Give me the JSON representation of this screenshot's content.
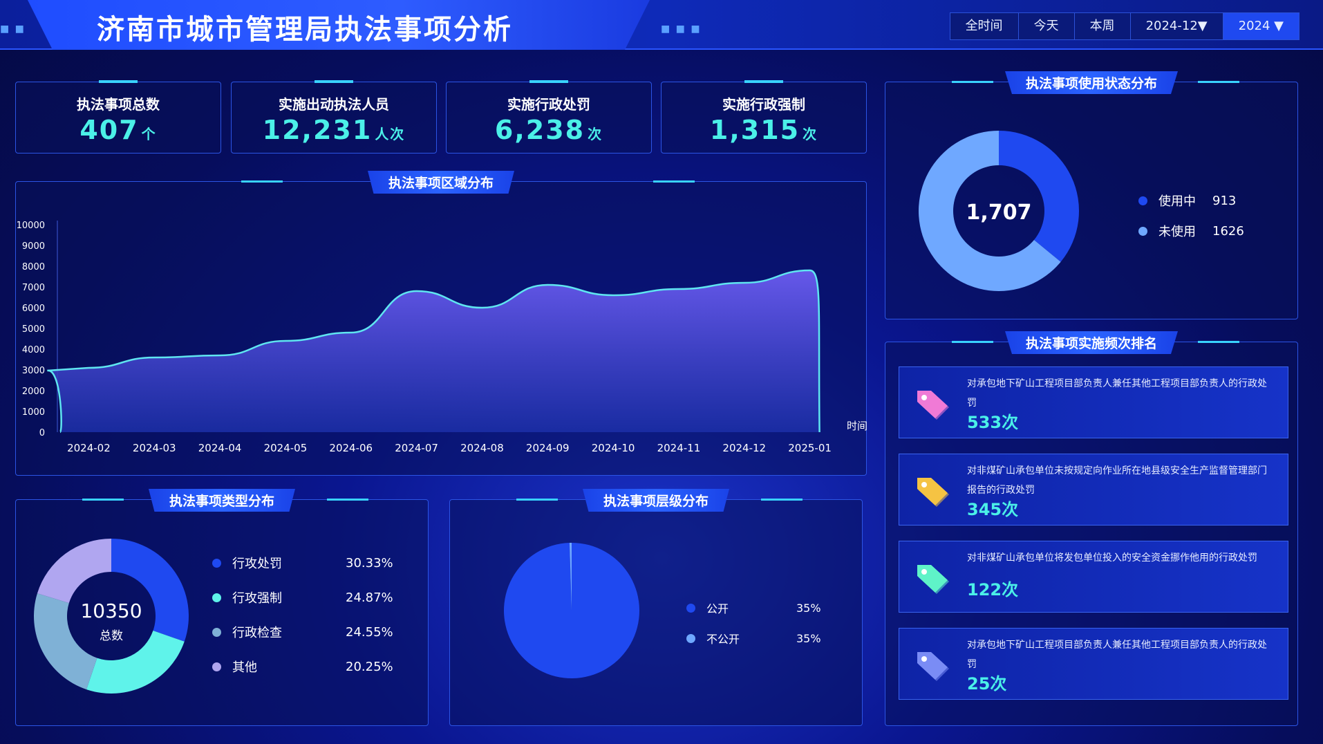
{
  "header": {
    "title": "济南市城市管理局执法事项分析",
    "filters": [
      "全时间",
      "今天",
      "本周",
      "2024-12▼",
      "2024 ▼"
    ]
  },
  "kpis": [
    {
      "label": "执法事项总数",
      "value": "407",
      "unit": "个"
    },
    {
      "label": "实施出动执法人员",
      "value": "12,231",
      "unit": "人次"
    },
    {
      "label": "实施行政处罚",
      "value": "6,238",
      "unit": "次"
    },
    {
      "label": "实施行政强制",
      "value": "1,315",
      "unit": "次"
    }
  ],
  "panels": {
    "region": "执法事项区域分布",
    "status": "执法事项使用状态分布",
    "type": "执法事项类型分布",
    "level": "执法事项层级分布",
    "rank": "执法事项实施频次排名"
  },
  "colors": {
    "accent": "#39d3ff",
    "teal": "#4bf0e8",
    "blue": "#1f49f0",
    "lightblue": "#6fa8ff",
    "aqua": "#5ff3ea",
    "slate": "#7fb1d6",
    "lavender": "#b0a6f0"
  },
  "chart_data": [
    {
      "type": "area",
      "xlabel": "时间",
      "ylabel": "",
      "ylim": [
        0,
        10000
      ],
      "yticks": [
        0,
        1000,
        2000,
        3000,
        4000,
        5000,
        6000,
        7000,
        8000,
        9000,
        10000
      ],
      "categories": [
        "2024-02",
        "2024-03",
        "2024-04",
        "2024-05",
        "2024-06",
        "2024-07",
        "2024-08",
        "2024-09",
        "2024-10",
        "2024-11",
        "2024-12",
        "2025-01"
      ],
      "values": [
        3100,
        3600,
        3700,
        4400,
        4800,
        6800,
        6000,
        7100,
        6600,
        6900,
        7200,
        7800
      ],
      "grid": false
    },
    {
      "type": "pie",
      "center_value": "1,707",
      "labels": [
        "使用中",
        "未使用"
      ],
      "values": [
        913,
        1626
      ]
    },
    {
      "type": "pie",
      "center_value": "10350",
      "center_label": "总数",
      "labels": [
        "行攻处罚",
        "行攻强制",
        "行政检查",
        "其他"
      ],
      "percents": [
        "30.33%",
        "24.87%",
        "24.55%",
        "20.25%"
      ],
      "values": [
        30.33,
        24.87,
        24.55,
        20.25
      ]
    },
    {
      "type": "pie",
      "labels": [
        "公开",
        "不公开"
      ],
      "percents": [
        "35%",
        "35%"
      ],
      "values": [
        99.5,
        0.5
      ]
    }
  ],
  "status_legend": [
    {
      "label": "使用中",
      "value": "913"
    },
    {
      "label": "未使用",
      "value": "1626"
    }
  ],
  "type_legend": [
    {
      "label": "行攻处罚",
      "pct": "30.33%"
    },
    {
      "label": "行攻强制",
      "pct": "24.87%"
    },
    {
      "label": "行政检查",
      "pct": "24.55%"
    },
    {
      "label": "其他",
      "pct": "20.25%"
    }
  ],
  "level_legend": [
    {
      "label": "公开",
      "pct": "35%"
    },
    {
      "label": "不公开",
      "pct": "35%"
    }
  ],
  "ranking": [
    {
      "text": "对承包地下矿山工程项目部负责人兼任其他工程项目部负责人的行政处罚",
      "count": "533次",
      "icon_color": "#f07ad6"
    },
    {
      "text": "对非煤矿山承包单位未按规定向作业所在地县级安全生产监督管理部门报告的行政处罚",
      "count": "345次",
      "icon_color": "#f5c343"
    },
    {
      "text": "对非煤矿山承包单位将发包单位投入的安全资金挪作他用的行政处罚",
      "count": "122次",
      "icon_color": "#5ff3c8"
    },
    {
      "text": "对承包地下矿山工程项目部负责人兼任其他工程项目部负责人的行政处罚",
      "count": "25次",
      "icon_color": "#7a8cf5"
    }
  ]
}
